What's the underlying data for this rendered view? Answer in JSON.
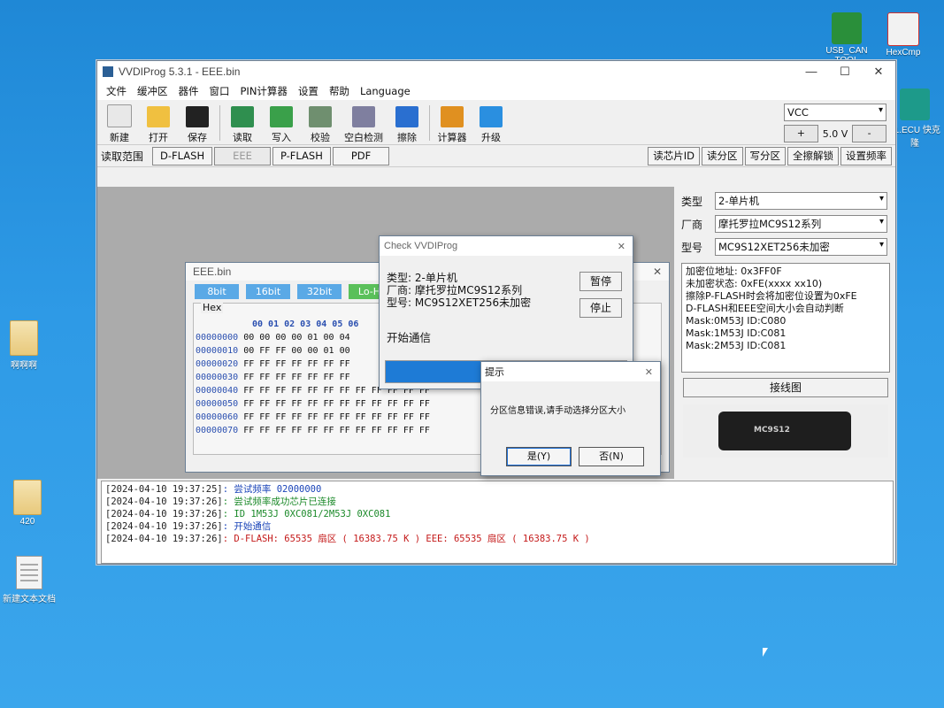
{
  "desktop": {
    "icons": [
      {
        "label": "USB_CAN TOOL",
        "name": "usb-can-tool"
      },
      {
        "label": "HexCmp",
        "name": "hexcmp"
      },
      {
        "label": "31.ECU 快克隆",
        "name": "ecu-clone"
      },
      {
        "label": "啊啊啊",
        "name": "folder-aaa"
      },
      {
        "label": "420",
        "name": "folder-420"
      },
      {
        "label": "新建文本文档",
        "name": "new-text-doc"
      }
    ]
  },
  "window": {
    "title": "VVDIProg 5.3.1 - EEE.bin",
    "controls": {
      "minimize": "—",
      "maximize": "☐",
      "close": "✕"
    }
  },
  "menu": [
    "文件",
    "缓冲区",
    "器件",
    "窗口",
    "PIN计算器",
    "设置",
    "帮助",
    "Language"
  ],
  "toolbar": {
    "buttons": [
      {
        "label": "新建",
        "icon": "new-file-icon",
        "color": "#e8e8e8"
      },
      {
        "label": "打开",
        "icon": "folder-open-icon",
        "color": "#f0c040"
      },
      {
        "label": "保存",
        "icon": "save-icon",
        "color": "#222222"
      },
      {
        "label": "读取",
        "icon": "read-chip-icon",
        "color": "#2f8f4f"
      },
      {
        "label": "写入",
        "icon": "write-chip-icon",
        "color": "#3aa04a"
      },
      {
        "label": "校验",
        "icon": "verify-icon",
        "color": "#6f8f6f"
      },
      {
        "label": "空白检测",
        "icon": "blank-check-icon",
        "color": "#7f7f9f"
      },
      {
        "label": "擦除",
        "icon": "erase-icon",
        "color": "#2a6fd0"
      },
      {
        "label": "计算器",
        "icon": "calculator-icon",
        "color": "#e09020"
      },
      {
        "label": "升级",
        "icon": "upgrade-arrow-icon",
        "color": "#2a8fe0"
      }
    ],
    "vcc": {
      "selected": "VCC",
      "plus": "+",
      "voltage": "5.0 V",
      "minus": "-"
    }
  },
  "range": {
    "label": "读取范围",
    "tabs": [
      "D-FLASH",
      "EEE",
      "P-FLASH",
      "PDF"
    ],
    "selected_tab": "EEE",
    "right_buttons": [
      "读芯片ID",
      "读分区",
      "写分区",
      "全擦解锁",
      "设置频率"
    ]
  },
  "right_panel": {
    "type_label": "类型",
    "type_value": "2-单片机",
    "maker_label": "厂商",
    "maker_value": "摩托罗拉MC9S12系列",
    "model_label": "型号",
    "model_value": "MC9S12XET256未加密",
    "info_lines": [
      "加密位地址: 0x3FF0F",
      "未加密状态: 0xFE(xxxx xx10)",
      "擦除P-FLASH时会将加密位设置为0xFE",
      "D-FLASH和EEE空间大小会自动判断",
      "Mask:0M53J ID:C080",
      "Mask:1M53J ID:C081",
      "Mask:2M53J ID:C081"
    ],
    "wiring_button": "接线图",
    "cable_label": "MC9S12"
  },
  "log": [
    {
      "time": "[2024-04-10 19:37:25]",
      "text": ": 尝试频率  02000000",
      "color": "#1a44b8"
    },
    {
      "time": "[2024-04-10 19:37:26]",
      "text": ": 尝试频率成功芯片已连接",
      "color": "#1c8a2a"
    },
    {
      "time": "[2024-04-10 19:37:26]",
      "text": ": ID  1M53J 0XC081/2M53J 0XC081",
      "color": "#1c8a2a"
    },
    {
      "time": "[2024-04-10 19:37:26]",
      "text": ": 开始通信",
      "color": "#1a44b8"
    },
    {
      "time": "[2024-04-10 19:37:26]",
      "text": ": D-FLASH: 65535 扇区 ( 16383.75 K )        EEE: 65535 扇区 ( 16383.75 K )",
      "color": "#c41a1a"
    }
  ],
  "eee_window": {
    "title": "EEE.bin",
    "modes": [
      "8bit",
      "16bit",
      "32bit",
      "Lo-Hi"
    ],
    "hex_caption": "Hex",
    "header": "00 01 02 03 04 05 06",
    "rows": [
      {
        "addr": "00000000",
        "bytes": "00 00 00 00 01 00 04"
      },
      {
        "addr": "00000010",
        "bytes": "00 FF FF 00 00 01 00"
      },
      {
        "addr": "00000020",
        "bytes": "FF FF FF FF FF FF FF"
      },
      {
        "addr": "00000030",
        "bytes": "FF FF FF FF FF FF FF"
      },
      {
        "addr": "00000040",
        "bytes": "FF FF FF FF FF FF FF FF FF FF FF FF"
      },
      {
        "addr": "00000050",
        "bytes": "FF FF FF FF FF FF FF FF FF FF FF FF"
      },
      {
        "addr": "00000060",
        "bytes": "FF FF FF FF FF FF FF FF FF FF FF FF"
      },
      {
        "addr": "00000070",
        "bytes": "FF FF FF FF FF FF FF FF FF FF FF FF"
      }
    ]
  },
  "check_dialog": {
    "title": "Check VVDIProg",
    "lines": [
      "类型:  2-单片机",
      "厂商:  摩托罗拉MC9S12系列",
      "型号:  MC9S12XET256未加密"
    ],
    "pause_button": "暂停",
    "stop_button": "停止",
    "status": "开始通信",
    "progress": 0.4
  },
  "prompt_dialog": {
    "title": "提示",
    "message": "分区信息错误,请手动选择分区大小",
    "yes_button": "是(Y)",
    "no_button": "否(N)"
  }
}
